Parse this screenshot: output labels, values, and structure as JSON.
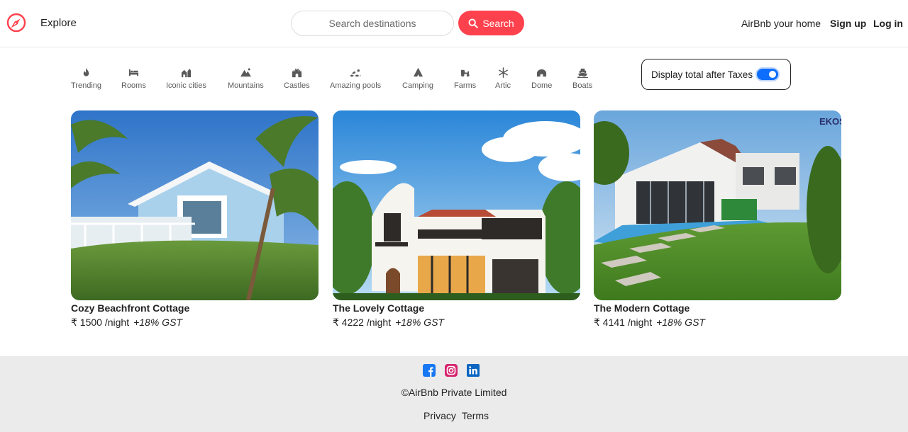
{
  "nav": {
    "explore": "Explore",
    "search_placeholder": "Search destinations",
    "search_button": "Search",
    "host": "AirBnb your home",
    "signup": "Sign up",
    "login": "Log in",
    "brand_icon": "compass-icon",
    "brand_color": "#fe424d"
  },
  "filters": [
    {
      "label": "Trending",
      "icon": "fire-icon"
    },
    {
      "label": "Rooms",
      "icon": "bed-icon"
    },
    {
      "label": "Iconic cities",
      "icon": "city-icon"
    },
    {
      "label": "Mountains",
      "icon": "mountain-icon"
    },
    {
      "label": "Castles",
      "icon": "castle-icon"
    },
    {
      "label": "Amazing pools",
      "icon": "swimmer-icon"
    },
    {
      "label": "Camping",
      "icon": "tent-icon"
    },
    {
      "label": "Farms",
      "icon": "tractor-icon"
    },
    {
      "label": "Artic",
      "icon": "snowflake-icon"
    },
    {
      "label": "Dome",
      "icon": "dome-icon"
    },
    {
      "label": "Boats",
      "icon": "ship-icon"
    }
  ],
  "tax_toggle": {
    "label": "Display total after Taxes",
    "on": true
  },
  "listings": [
    {
      "title": "Cozy Beachfront Cottage",
      "price": "₹ 1500 /night",
      "tax": "+18% GST"
    },
    {
      "title": "The Lovely Cottage",
      "price": "₹ 4222 /night",
      "tax": "+18% GST"
    },
    {
      "title": "The Modern Cottage",
      "price": "₹ 4141 /night",
      "tax": "+18% GST"
    }
  ],
  "listing_badge": "EKOS",
  "footer": {
    "socials": [
      "facebook-icon",
      "instagram-icon",
      "linkedin-icon"
    ],
    "copyright": "©AirBnb Private Limited",
    "privacy": "Privacy",
    "terms": "Terms"
  }
}
